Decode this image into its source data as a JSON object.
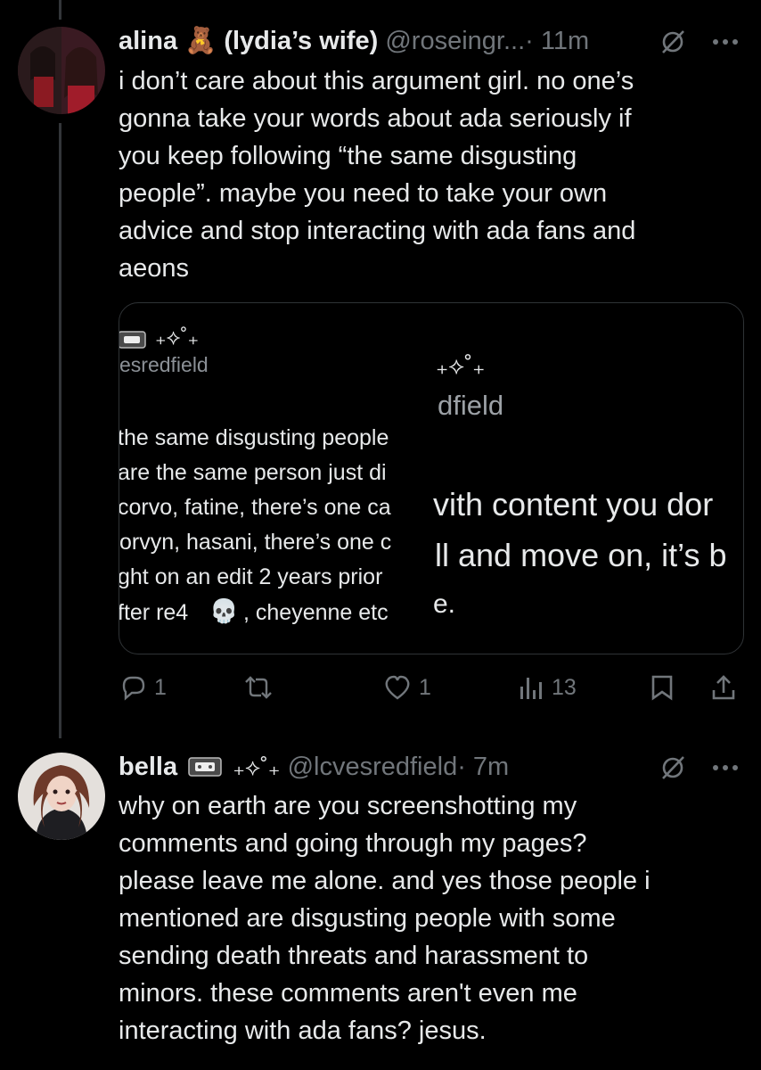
{
  "tweet1": {
    "display_name": "alina",
    "name_emoji": "🧸",
    "name_suffix": "(lydia’s wife)",
    "handle": "@roseingr...",
    "time": "· 11m",
    "text": "i don’t care about this argument girl. no one’s\ngonna take your words about ada seriously if\nyou keep following “the same disgusting\npeople”. maybe you need to take your own\nadvice and stop interacting with ada fans and\naeons",
    "quote": {
      "small_handle": "esredfield",
      "deco": "₊⟡˚₊",
      "big_deco": "₊⟡˚₊",
      "big_handle": "dfield",
      "left_lines": [
        "the same disgusting people",
        "are the same person just di",
        "corvo, fatine, there’s one ca",
        "orvyn, hasani, there’s one c",
        "ght on an edit 2 years prior",
        "fter re4",
        ", cheyenne etc"
      ],
      "skull": "💀",
      "right_lines": [
        "vith content you dor",
        "ll and move on, it’s b",
        "e."
      ]
    },
    "actions": {
      "replies": "1",
      "retweets": "",
      "likes": "1",
      "views": "13"
    }
  },
  "tweet2": {
    "display_name": "bella",
    "name_deco": "₊⟡˚₊",
    "handle": "@lcvesredfield",
    "time": "· 7m",
    "text": "why on earth are you screenshotting my\ncomments and going through my pages?\nplease leave me alone. and yes those people i\nmentioned are disgusting people with some\nsending death threats and harassment to\nminors. these comments aren't even me\ninteracting with ada fans? jesus."
  },
  "colors": {
    "background": "#000000",
    "text": "#e7e9ea",
    "secondary": "#71767b",
    "border": "#2f3336"
  }
}
